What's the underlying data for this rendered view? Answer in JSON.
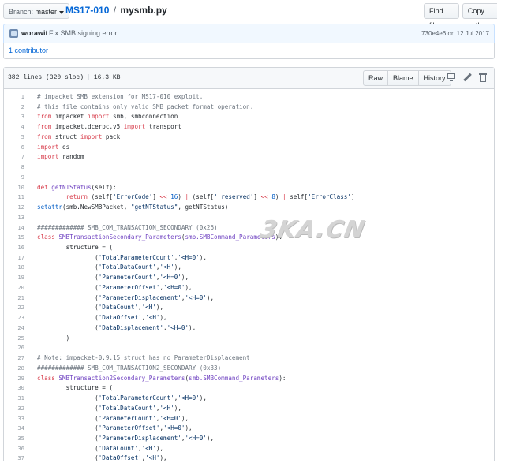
{
  "topbar": {
    "branch_label": "Branch:",
    "branch_value": "master",
    "repo": "MS17-010",
    "separator": "/",
    "filename": "mysmb.py",
    "find_file": "Find file",
    "copy_path": "Copy path"
  },
  "commit": {
    "author": "worawit",
    "message": "Fix SMB signing error",
    "sha": "730e4e6",
    "date_text": "on 12 Jul 2017"
  },
  "contributors": "1 contributor",
  "file": {
    "info_lines": "382 lines (320 sloc)",
    "info_size": "16.3 KB",
    "raw": "Raw",
    "blame": "Blame",
    "history": "History"
  },
  "watermark": "3KA.CN",
  "code_lines": [
    {
      "n": "1",
      "html": "<span class='c'># impacket SMB extension for MS17-010 exploit.</span>"
    },
    {
      "n": "2",
      "html": "<span class='c'># this file contains only valid SMB packet format operation.</span>"
    },
    {
      "n": "3",
      "html": "<span class='k'>from</span> impacket <span class='k'>import</span> smb, smbconnection"
    },
    {
      "n": "4",
      "html": "<span class='k'>from</span> impacket.dcerpc.v5 <span class='k'>import</span> transport"
    },
    {
      "n": "5",
      "html": "<span class='k'>from</span> struct <span class='k'>import</span> pack"
    },
    {
      "n": "6",
      "html": "<span class='k'>import</span> os"
    },
    {
      "n": "7",
      "html": "<span class='k'>import</span> random"
    },
    {
      "n": "8",
      "html": ""
    },
    {
      "n": "9",
      "html": ""
    },
    {
      "n": "10",
      "html": "<span class='k'>def</span> <span class='f'>getNTStatus</span>(self):"
    },
    {
      "n": "11",
      "html": "        <span class='k'>return</span> (self[<span class='s'>'ErrorCode'</span>] <span class='k'>&lt;&lt;</span> <span class='n'>16</span>) <span class='k'>|</span> (self[<span class='s'>'_reserved'</span>] <span class='k'>&lt;&lt;</span> <span class='n'>8</span>) <span class='k'>|</span> self[<span class='s'>'ErrorClass'</span>]"
    },
    {
      "n": "12",
      "html": "<span class='n'>setattr</span>(smb.NewSMBPacket, <span class='s'>\"getNTStatus\"</span>, getNTStatus)"
    },
    {
      "n": "13",
      "html": ""
    },
    {
      "n": "14",
      "html": "<span class='c'>############# SMB_COM_TRANSACTION_SECONDARY (0x26)</span>"
    },
    {
      "n": "15",
      "html": "<span class='k'>class</span> <span class='f'>SMBTransactionSecondary_Parameters</span>(<span class='f'>smb.SMBCommand_Parameters</span>):"
    },
    {
      "n": "16",
      "html": "        structure = ("
    },
    {
      "n": "17",
      "html": "                (<span class='s'>'TotalParameterCount'</span>,<span class='s'>'&lt;H=0'</span>),"
    },
    {
      "n": "18",
      "html": "                (<span class='s'>'TotalDataCount'</span>,<span class='s'>'&lt;H'</span>),"
    },
    {
      "n": "19",
      "html": "                (<span class='s'>'ParameterCount'</span>,<span class='s'>'&lt;H=0'</span>),"
    },
    {
      "n": "20",
      "html": "                (<span class='s'>'ParameterOffset'</span>,<span class='s'>'&lt;H=0'</span>),"
    },
    {
      "n": "21",
      "html": "                (<span class='s'>'ParameterDisplacement'</span>,<span class='s'>'&lt;H=0'</span>),"
    },
    {
      "n": "22",
      "html": "                (<span class='s'>'DataCount'</span>,<span class='s'>'&lt;H'</span>),"
    },
    {
      "n": "23",
      "html": "                (<span class='s'>'DataOffset'</span>,<span class='s'>'&lt;H'</span>),"
    },
    {
      "n": "24",
      "html": "                (<span class='s'>'DataDisplacement'</span>,<span class='s'>'&lt;H=0'</span>),"
    },
    {
      "n": "25",
      "html": "        )"
    },
    {
      "n": "26",
      "html": ""
    },
    {
      "n": "27",
      "html": "<span class='c'># Note: impacket-0.9.15 struct has no ParameterDisplacement</span>"
    },
    {
      "n": "28",
      "html": "<span class='c'>############# SMB_COM_TRANSACTION2_SECONDARY (0x33)</span>"
    },
    {
      "n": "29",
      "html": "<span class='k'>class</span> <span class='f'>SMBTransaction2Secondary_Parameters</span>(<span class='f'>smb.SMBCommand_Parameters</span>):"
    },
    {
      "n": "30",
      "html": "        structure = ("
    },
    {
      "n": "31",
      "html": "                (<span class='s'>'TotalParameterCount'</span>,<span class='s'>'&lt;H=0'</span>),"
    },
    {
      "n": "32",
      "html": "                (<span class='s'>'TotalDataCount'</span>,<span class='s'>'&lt;H'</span>),"
    },
    {
      "n": "33",
      "html": "                (<span class='s'>'ParameterCount'</span>,<span class='s'>'&lt;H=0'</span>),"
    },
    {
      "n": "34",
      "html": "                (<span class='s'>'ParameterOffset'</span>,<span class='s'>'&lt;H=0'</span>),"
    },
    {
      "n": "35",
      "html": "                (<span class='s'>'ParameterDisplacement'</span>,<span class='s'>'&lt;H=0'</span>),"
    },
    {
      "n": "36",
      "html": "                (<span class='s'>'DataCount'</span>,<span class='s'>'&lt;H'</span>),"
    },
    {
      "n": "37",
      "html": "                (<span class='s'>'DataOffset'</span>,<span class='s'>'&lt;H'</span>),"
    }
  ]
}
